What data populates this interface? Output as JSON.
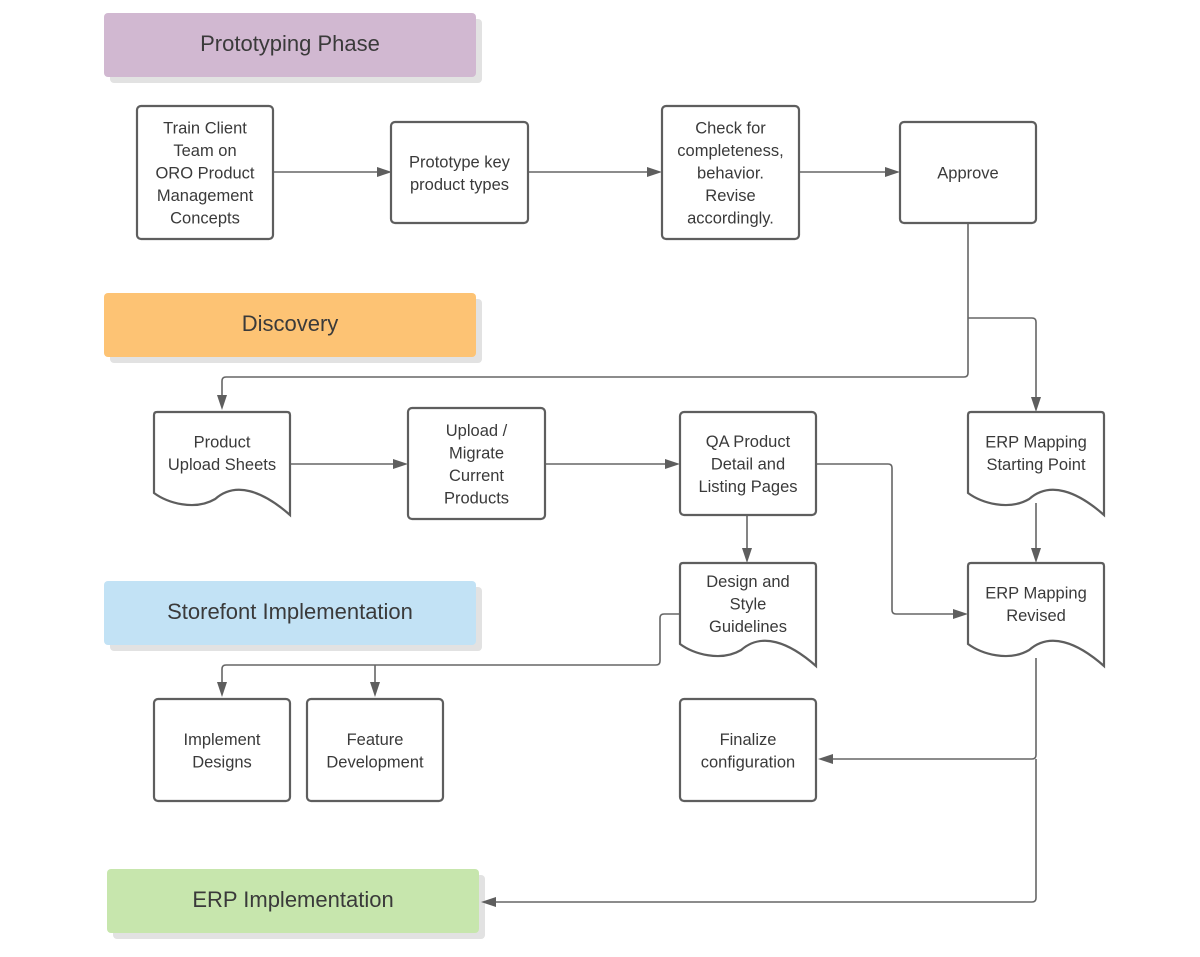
{
  "diagram": {
    "type": "flowchart",
    "phases": [
      {
        "id": "prototyping",
        "label": "Prototyping Phase",
        "color": "#d1b8d1"
      },
      {
        "id": "discovery",
        "label": "Discovery",
        "color": "#fdc374"
      },
      {
        "id": "storefront",
        "label": "Storefont Implementation",
        "color": "#c2e2f5"
      },
      {
        "id": "erp",
        "label": "ERP Implementation",
        "color": "#c7e6ad"
      }
    ],
    "nodes": [
      {
        "id": "train",
        "shape": "process",
        "lines": [
          "Train Client",
          "Team on",
          "ORO Product",
          "Management",
          "Concepts"
        ]
      },
      {
        "id": "prototype",
        "shape": "process",
        "lines": [
          "Prototype key",
          "product types"
        ]
      },
      {
        "id": "check",
        "shape": "process",
        "lines": [
          "Check for",
          "completeness,",
          "behavior.",
          "Revise",
          "accordingly."
        ]
      },
      {
        "id": "approve",
        "shape": "process",
        "lines": [
          "Approve"
        ]
      },
      {
        "id": "upload_sheets",
        "shape": "document",
        "lines": [
          "Product",
          "Upload Sheets"
        ]
      },
      {
        "id": "migrate",
        "shape": "process",
        "lines": [
          "Upload /",
          "Migrate",
          "Current",
          "Products"
        ]
      },
      {
        "id": "qa",
        "shape": "process",
        "lines": [
          "QA Product",
          "Detail and",
          "Listing Pages"
        ]
      },
      {
        "id": "erp_start",
        "shape": "document",
        "lines": [
          "ERP Mapping",
          "Starting Point"
        ]
      },
      {
        "id": "design_guidelines",
        "shape": "document",
        "lines": [
          "Design and",
          "Style",
          "Guidelines"
        ]
      },
      {
        "id": "erp_revised",
        "shape": "document",
        "lines": [
          "ERP Mapping",
          "Revised"
        ]
      },
      {
        "id": "implement_designs",
        "shape": "process",
        "lines": [
          "Implement",
          "Designs"
        ]
      },
      {
        "id": "feature_dev",
        "shape": "process",
        "lines": [
          "Feature",
          "Development"
        ]
      },
      {
        "id": "finalize",
        "shape": "process",
        "lines": [
          "Finalize",
          "configuration"
        ]
      }
    ],
    "edges": [
      {
        "from": "train",
        "to": "prototype"
      },
      {
        "from": "prototype",
        "to": "check"
      },
      {
        "from": "check",
        "to": "approve"
      },
      {
        "from": "approve",
        "to": "upload_sheets"
      },
      {
        "from": "approve",
        "to": "erp_start"
      },
      {
        "from": "upload_sheets",
        "to": "migrate"
      },
      {
        "from": "migrate",
        "to": "qa"
      },
      {
        "from": "qa",
        "to": "design_guidelines"
      },
      {
        "from": "qa",
        "to": "erp_revised"
      },
      {
        "from": "erp_start",
        "to": "erp_revised"
      },
      {
        "from": "design_guidelines",
        "to": "implement_designs"
      },
      {
        "from": "design_guidelines",
        "to": "feature_dev"
      },
      {
        "from": "erp_revised",
        "to": "finalize"
      },
      {
        "from": "erp_revised",
        "to": "erp"
      }
    ]
  }
}
